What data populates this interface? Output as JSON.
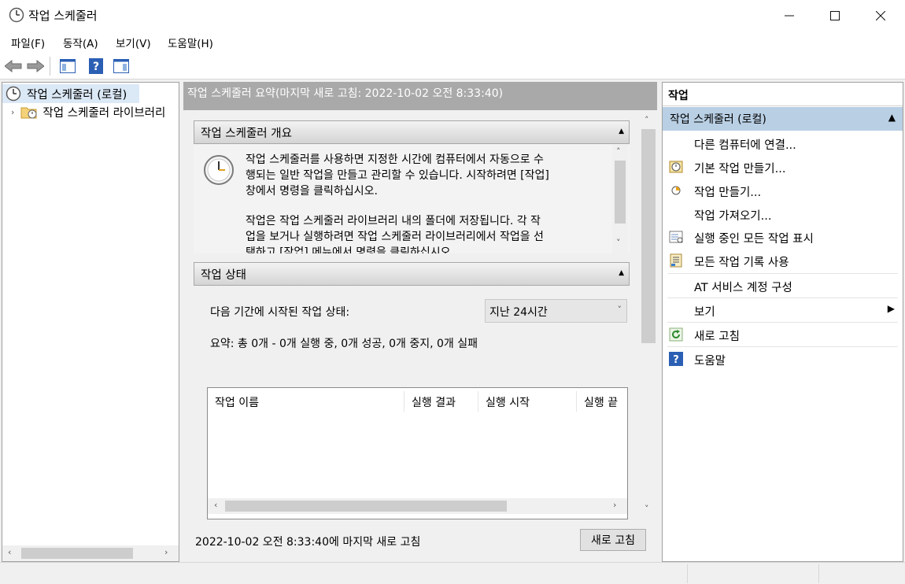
{
  "window": {
    "title": "작업 스케줄러"
  },
  "menu": [
    "파일(F)",
    "동작(A)",
    "보기(V)",
    "도움말(H)"
  ],
  "tree": {
    "root": "작업 스케줄러 (로컬)",
    "child": "작업 스케줄러 라이브러리"
  },
  "center": {
    "header": "작업 스케줄러 요약(마지막 새로 고침: 2022-10-02 오전 8:33:40)",
    "overview": {
      "title": "작업 스케줄러 개요",
      "para1": [
        "작업 스케줄러를 사용하면 지정한 시간에 컴퓨터에서 자동으로 수",
        "행되는 일반 작업을 만들고 관리할 수 있습니다. 시작하려면 [작업]",
        "창에서 명령을 클릭하십시오."
      ],
      "para2": [
        "작업은 작업 스케줄러 라이브러리 내의 폴더에 저장됩니다. 각 작",
        "업을 보거나 실행하려면 작업 스케줄러 라이브러리에서 작업을 선",
        "택하고 [작업] 메뉴에서 명령을 클릭하십시오."
      ]
    },
    "status": {
      "title": "작업 상태",
      "period_label": "다음 기간에 시작된 작업 상태:",
      "period_value": "지난 24시간",
      "summary": "요약: 총 0개 - 0개 실행 중, 0개 성공, 0개 중지, 0개 실패",
      "columns": [
        "작업 이름",
        "실행 결과",
        "실행 시작",
        "실행 끝"
      ]
    },
    "footer": {
      "last_refresh": "2022-10-02 오전 8:33:40에 마지막 새로 고침",
      "refresh_button": "새로 고침"
    }
  },
  "actions": {
    "title": "작업",
    "section": "작업 스케줄러 (로컬)",
    "items": [
      {
        "label": "다른 컴퓨터에 연결...",
        "icon": "none"
      },
      {
        "label": "기본 작업 만들기...",
        "icon": "basic-task-icon"
      },
      {
        "label": "작업 만들기...",
        "icon": "create-task-icon"
      },
      {
        "label": "작업 가져오기...",
        "icon": "none"
      },
      {
        "label": "실행 중인 모든 작업 표시",
        "icon": "running-tasks-icon"
      },
      {
        "label": "모든 작업 기록 사용",
        "icon": "history-icon"
      },
      {
        "label": "AT 서비스 계정 구성",
        "icon": "none"
      },
      {
        "label": "보기",
        "icon": "none"
      },
      {
        "label": "새로 고침",
        "icon": "refresh-icon"
      },
      {
        "label": "도움말",
        "icon": "help-icon"
      }
    ]
  },
  "colors": {
    "selection": "#b9cfe4",
    "header_gray": "#a9a9a9",
    "accent_blue": "#2b5fb4"
  }
}
